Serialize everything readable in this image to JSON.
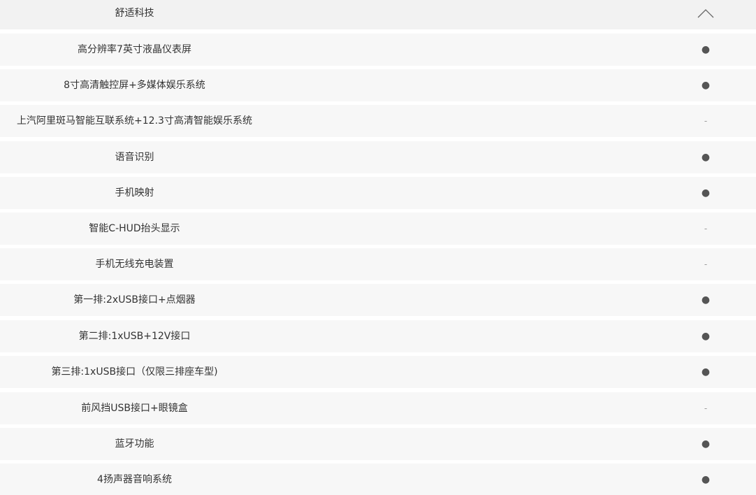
{
  "section": {
    "title": "舒适科技",
    "toggle_icon": "chevron-up-icon"
  },
  "rows": [
    {
      "label": "高分辨率7英寸液晶仪表屏",
      "value": "●"
    },
    {
      "label": "8寸高清触控屏+多媒体娱乐系统",
      "value": "●"
    },
    {
      "label": "上汽阿里斑马智能互联系统+12.3寸高清智能娱乐系统",
      "value": "-"
    },
    {
      "label": "语音识别",
      "value": "●"
    },
    {
      "label": "手机映射",
      "value": "●"
    },
    {
      "label": "智能C-HUD抬头显示",
      "value": "-"
    },
    {
      "label": "手机无线充电装置",
      "value": "-"
    },
    {
      "label": "第一排:2xUSB接口+点烟器",
      "value": "●"
    },
    {
      "label": "第二排:1xUSB+12V接口",
      "value": "●"
    },
    {
      "label": "第三排:1xUSB接口（仅限三排座车型)",
      "value": "●"
    },
    {
      "label": "前风挡USB接口+眼镜盒",
      "value": "-"
    },
    {
      "label": "蓝牙功能",
      "value": "●"
    },
    {
      "label": "4扬声器音响系统",
      "value": "●"
    }
  ]
}
